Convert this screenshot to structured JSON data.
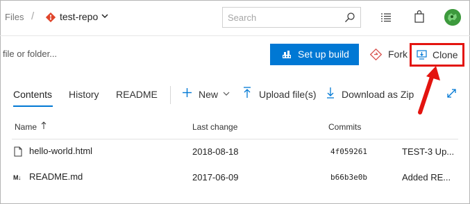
{
  "header": {
    "breadcrumb_root": "Files",
    "breadcrumb_separator": "/",
    "repo_name": "test-repo",
    "repo_icon": "git-repo-icon",
    "search_placeholder": "Search",
    "search_icon": "search-icon"
  },
  "toolbar": {
    "filter_placeholder": "file or folder...",
    "setup_build_label": "Set up build",
    "fork_label": "Fork",
    "clone_label": "Clone",
    "accent_color": "#0078d4",
    "highlight_color": "#e3140f"
  },
  "tabs": [
    {
      "label": "Contents",
      "active": true
    },
    {
      "label": "History",
      "active": false
    },
    {
      "label": "README",
      "active": false
    }
  ],
  "actions": {
    "new_label": "New",
    "upload_label": "Upload file(s)",
    "download_label": "Download as Zip"
  },
  "table": {
    "columns": [
      "Name",
      "Last change",
      "Commits"
    ],
    "rows": [
      {
        "icon": "file-icon",
        "name": "hello-world.html",
        "date": "2018-08-18",
        "commit": "4f059261",
        "message": "TEST-3 Up..."
      },
      {
        "icon": "markdown-icon",
        "name": "README.md",
        "date": "2017-06-09",
        "commit": "b66b3e0b",
        "message": "Added RE..."
      }
    ]
  }
}
